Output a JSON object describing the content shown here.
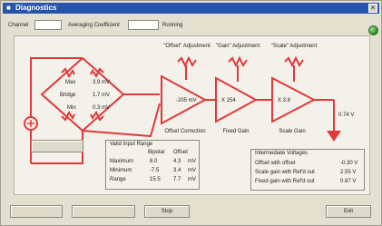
{
  "window": {
    "title": "Diagnostics",
    "close_glyph": "×"
  },
  "toolbar": {
    "channel_label": "Channel",
    "channel_value": "",
    "averaging_label": "Averaging Coefficient",
    "averaging_value": "",
    "status_label": "Running",
    "status_color": "#1d8a1d"
  },
  "circuit": {
    "adjust_labels": [
      "\"Offset\" Adjustment",
      "\"Gain\" Adjustment",
      "\"Scale\" Adjustment"
    ],
    "amp_values": [
      "-205 mV",
      "X 254",
      "X 3.8"
    ],
    "amp_captions": [
      "Offset Correction",
      "Fixed Gain",
      "Scale Gain"
    ],
    "bridge_rows": [
      {
        "label": "Max",
        "value": "3.9 mV"
      },
      {
        "label": "Bridge",
        "value": "1.7 mV"
      },
      {
        "label": "Min",
        "value": "0.3 mV"
      }
    ],
    "output_value": "0.74 V",
    "sensor_button": "",
    "wire_color": "#e0393b"
  },
  "input_range": {
    "title": "Valid Input Range",
    "col_headers": [
      "Bipolar",
      "Offset"
    ],
    "rows": [
      {
        "label": "Maximum",
        "a": "8.0",
        "b": "4.3",
        "unit": "mV"
      },
      {
        "label": "Minimum",
        "a": "-7.5",
        "b": "3.4",
        "unit": "mV"
      },
      {
        "label": "Range",
        "a": "15.5",
        "b": "7.7",
        "unit": "mV"
      }
    ]
  },
  "intermediate": {
    "title": "Intermediate Voltages",
    "rows": [
      {
        "label": "Offset with offset",
        "value": "-0.30 V"
      },
      {
        "label": "Scale gain with Ref'd out",
        "value": "2.55 V"
      },
      {
        "label": "Fixed gain with Ref'd out",
        "value": "0.87 V"
      }
    ]
  },
  "bottom_buttons": [
    "",
    "",
    "Stop",
    "Exit"
  ]
}
